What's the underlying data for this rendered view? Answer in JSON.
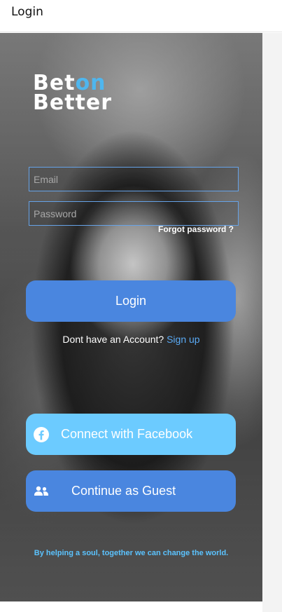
{
  "window": {
    "title": "Login"
  },
  "logo": {
    "line1_a": "Bet",
    "line1_b": "on",
    "line2": "Better"
  },
  "form": {
    "email_placeholder": "Email",
    "password_placeholder": "Password",
    "forgot_label": "Forgot password ?",
    "login_label": "Login"
  },
  "signup": {
    "prompt": "Dont have an Account?",
    "link": "Sign up"
  },
  "social": {
    "facebook_label": "Connect with Facebook",
    "facebook_icon": "facebook-icon",
    "guest_label": "Continue as Guest",
    "guest_icon": "users-icon"
  },
  "footer": {
    "tagline": "By helping a soul, together we can change the world."
  },
  "colors": {
    "primary": "#4a86df",
    "facebook": "#6ccbff",
    "accent": "#4fb6ee",
    "link": "#5aaaf5",
    "tagline": "#5bc3ff"
  }
}
